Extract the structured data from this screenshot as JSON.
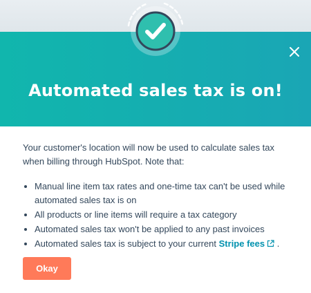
{
  "dialog": {
    "title": "Automated sales tax is on!",
    "intro": "Your customer's location will now be used to calculate sales tax when billing through HubSpot. Note that:",
    "bullets": [
      "Manual line item tax rates and one-time tax can't be used while automated sales tax is on",
      "All products or line items will require a tax category",
      "Automated sales tax won't be applied to any past invoices"
    ],
    "last_bullet": {
      "prefix": "Automated sales tax is subject to your current ",
      "link_label": "Stripe fees",
      "suffix": " ."
    },
    "okay_label": "Okay"
  },
  "icons": {
    "badge": "checkmark-icon",
    "close": "close-icon",
    "external": "external-link-icon"
  },
  "colors": {
    "header_start": "#11b6ad",
    "header_end": "#1aa6b5",
    "badge_fill": "#2fbfae",
    "badge_ring": "#33475b",
    "body_text": "#33475b",
    "link": "#0091ae",
    "primary_button": "#ff7a59"
  }
}
